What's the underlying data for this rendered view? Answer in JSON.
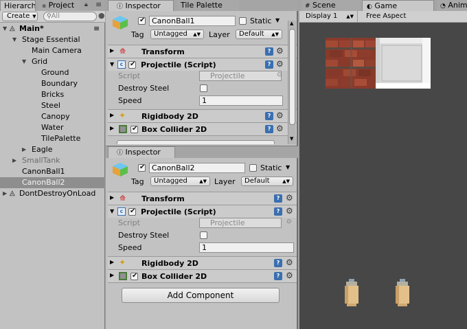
{
  "hierarchy": {
    "tabs": [
      "Hierarch",
      "Project"
    ],
    "create_label": "Create",
    "search_placeholder": "All",
    "items": [
      {
        "label": "Main*",
        "depth": 0,
        "bold": true,
        "expanded": true
      },
      {
        "label": "Stage Essential",
        "depth": 1,
        "expanded": true
      },
      {
        "label": "Main Camera",
        "depth": 2
      },
      {
        "label": "Grid",
        "depth": 2,
        "expanded": true
      },
      {
        "label": "Ground",
        "depth": 3
      },
      {
        "label": "Boundary",
        "depth": 3
      },
      {
        "label": "Bricks",
        "depth": 3
      },
      {
        "label": "Steel",
        "depth": 3
      },
      {
        "label": "Canopy",
        "depth": 3
      },
      {
        "label": "Water",
        "depth": 3
      },
      {
        "label": "TilePalette",
        "depth": 3
      },
      {
        "label": "Eagle",
        "depth": 2,
        "collapsed": true
      },
      {
        "label": "SmallTank",
        "depth": 1,
        "collapsed": true,
        "dim": true
      },
      {
        "label": "CanonBall1",
        "depth": 1
      },
      {
        "label": "CanonBall2",
        "depth": 1,
        "selected": true
      },
      {
        "label": "DontDestroyOnLoad",
        "depth": 0,
        "collapsed": true
      }
    ]
  },
  "inspector1": {
    "tabs": [
      "Inspector",
      "Tile Palette"
    ],
    "object_name": "CanonBall1",
    "static_label": "Static",
    "tag_label": "Tag",
    "tag_value": "Untagged",
    "layer_label": "Layer",
    "layer_value": "Default",
    "components": {
      "transform": "Transform",
      "projectile": "Projectile (Script)",
      "rigidbody": "Rigidbody 2D",
      "collider": "Box Collider 2D"
    },
    "script_label": "Script",
    "script_value": "Projectile",
    "destroy_steel_label": "Destroy Steel",
    "speed_label": "Speed",
    "speed_value": "1"
  },
  "inspector2": {
    "tab": "Inspector",
    "object_name": "CanonBall2",
    "static_label": "Static",
    "tag_label": "Tag",
    "tag_value": "Untagged",
    "layer_label": "Layer",
    "layer_value": "Default",
    "components": {
      "transform": "Transform",
      "projectile": "Projectile (Script)",
      "rigidbody": "Rigidbody 2D",
      "collider": "Box Collider 2D"
    },
    "script_label": "Script",
    "script_value": "Projectile",
    "destroy_steel_label": "Destroy Steel",
    "speed_label": "Speed",
    "speed_value": "1",
    "add_component": "Add Component"
  },
  "game": {
    "tabs": [
      "Scene",
      "Game",
      "Anim"
    ],
    "display": "Display 1",
    "aspect": "Free Aspect"
  },
  "colors": {
    "game_bg": "#474747",
    "selected_row": "#8e8e8e",
    "brick": "#8a3a2a",
    "steel": "#d9d9d9",
    "bullet": "#e3c089"
  }
}
